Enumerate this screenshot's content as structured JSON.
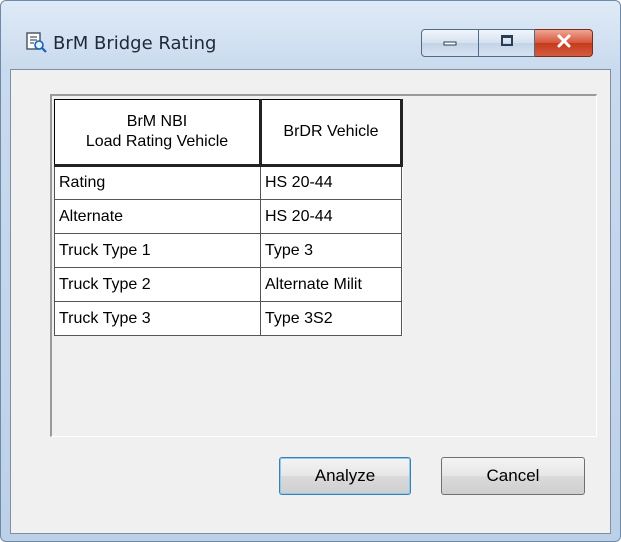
{
  "window": {
    "title": "BrM Bridge Rating",
    "icon": "bridge-rating-app-icon",
    "controls": {
      "minimize_icon": "minimize-icon",
      "maximize_icon": "maximize-icon",
      "close_icon": "close-icon"
    }
  },
  "grid": {
    "headers": {
      "col1_line1": "BrM NBI",
      "col1_line2": "Load Rating Vehicle",
      "col2": "BrDR Vehicle"
    },
    "rows": [
      {
        "nbi": "Rating",
        "brdr": "HS 20-44"
      },
      {
        "nbi": "Alternate",
        "brdr": "HS 20-44"
      },
      {
        "nbi": "Truck Type 1",
        "brdr": "Type 3"
      },
      {
        "nbi": "Truck Type 2",
        "brdr": "Alternate Milit"
      },
      {
        "nbi": "Truck Type 3",
        "brdr": "Type 3S2"
      }
    ]
  },
  "buttons": {
    "analyze_label": "Analyze",
    "cancel_label": "Cancel"
  },
  "colors": {
    "close_button": "#c43b1c",
    "default_button_border": "#3c7fb1"
  }
}
